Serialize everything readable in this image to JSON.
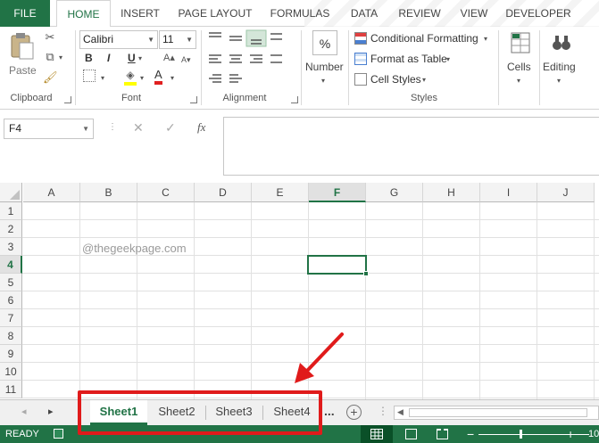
{
  "ribbon_tabs": [
    "FILE",
    "HOME",
    "INSERT",
    "PAGE LAYOUT",
    "FORMULAS",
    "DATA",
    "REVIEW",
    "VIEW",
    "DEVELOPER"
  ],
  "clipboard": {
    "paste_label": "Paste",
    "group_label": "Clipboard"
  },
  "font": {
    "name": "Calibri",
    "size": "11",
    "group_label": "Font",
    "bold": "B",
    "italic": "I",
    "underline": "U",
    "font_color": "A"
  },
  "alignment": {
    "group_label": "Alignment"
  },
  "number": {
    "icon": "%",
    "label": "Number"
  },
  "styles": {
    "conditional_formatting": "Conditional Formatting",
    "format_as_table": "Format as Table",
    "cell_styles": "Cell Styles",
    "group_label": "Styles"
  },
  "cells": {
    "label": "Cells"
  },
  "editing": {
    "label": "Editing"
  },
  "formula_bar": {
    "name_box": "F4",
    "cancel": "✕",
    "enter": "✓",
    "fx": "fx",
    "value": ""
  },
  "grid": {
    "columns": [
      "A",
      "B",
      "C",
      "D",
      "E",
      "F",
      "G",
      "H",
      "I",
      "J"
    ],
    "rows": [
      "1",
      "2",
      "3",
      "4",
      "5",
      "6",
      "7",
      "8",
      "9",
      "10",
      "11"
    ],
    "selected_column": "F",
    "selected_row": "4",
    "watermark_text": "@thegeekpage.com"
  },
  "sheet_tabs": [
    "Sheet1",
    "Sheet2",
    "Sheet3",
    "Sheet4"
  ],
  "sheet_nav": {
    "prev": "◂",
    "next": "▸",
    "more": "...",
    "add": "+"
  },
  "status": {
    "text": "READY",
    "zoom_partial": "10"
  },
  "colors": {
    "accent": "#217346",
    "annotation": "#e01b1b"
  }
}
